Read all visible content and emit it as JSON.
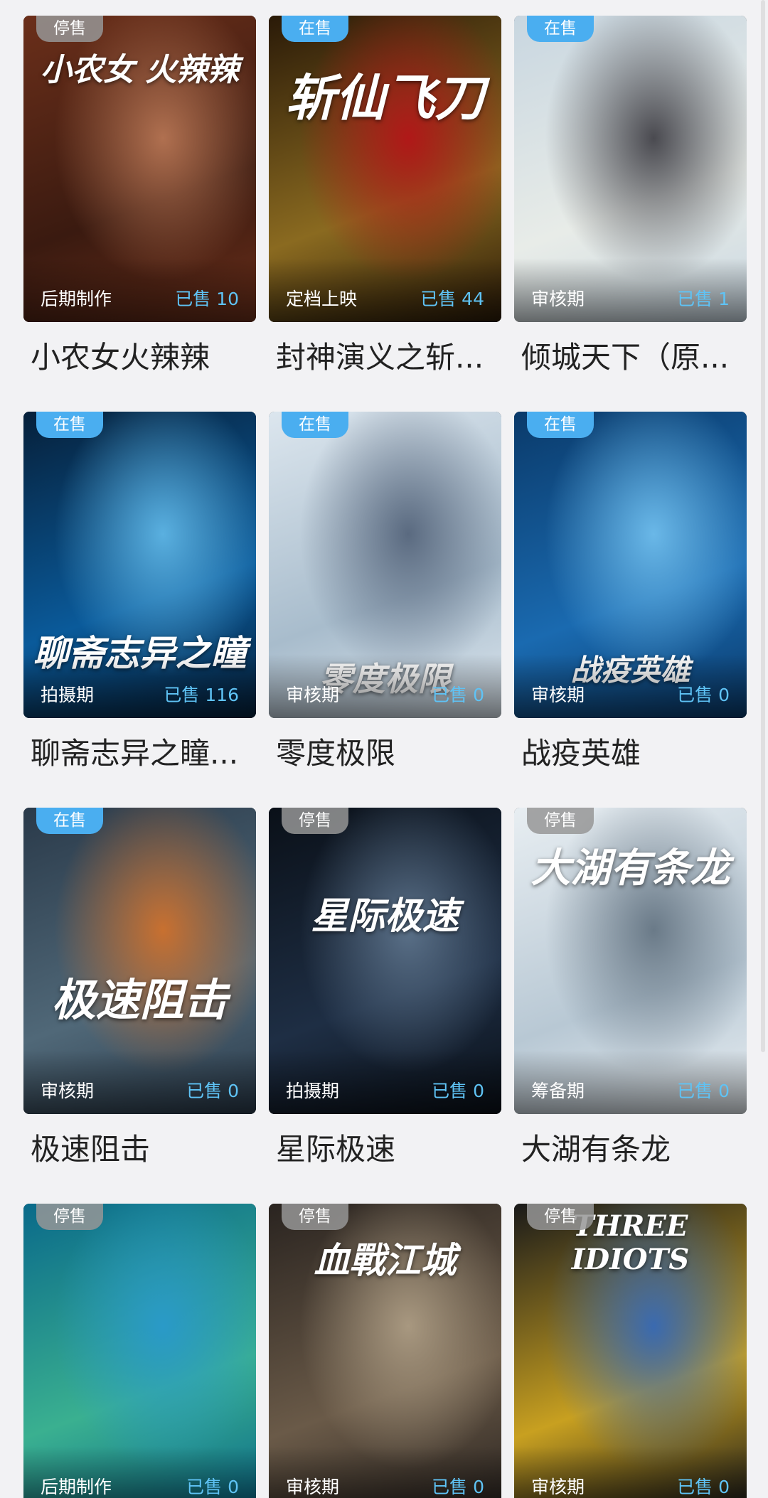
{
  "cards": [
    {
      "badge": "停售",
      "badge_state": "off",
      "stage": "后期制作",
      "sold": "已售 10",
      "name": "小农女火辣辣",
      "poster_text": "小农女 火辣辣",
      "colors": [
        "#6b2f1a",
        "#3a1a10",
        "#b07050"
      ]
    },
    {
      "badge": "在售",
      "badge_state": "on",
      "stage": "定档上映",
      "sold": "已售 44",
      "name": "封神演义之斩...",
      "poster_text": "斩仙飞刀",
      "colors": [
        "#2a1a08",
        "#8a6a20",
        "#b01818"
      ]
    },
    {
      "badge": "在售",
      "badge_state": "on",
      "stage": "审核期",
      "sold": "已售 1",
      "name": "倾城天下（原...",
      "poster_text": "",
      "colors": [
        "#c8d6e0",
        "#e8ece8",
        "#4a4a50"
      ]
    },
    {
      "badge": "在售",
      "badge_state": "on",
      "stage": "拍摄期",
      "sold": "已售 116",
      "name": "聊斋志异之瞳...",
      "poster_text": "聊斋志异之瞳",
      "colors": [
        "#06203a",
        "#0a5a9a",
        "#5ab0e0"
      ]
    },
    {
      "badge": "在售",
      "badge_state": "on",
      "stage": "审核期",
      "sold": "已售 0",
      "name": "零度极限",
      "poster_text": "零度极限",
      "colors": [
        "#dce6ee",
        "#a8bccc",
        "#5a6a80"
      ]
    },
    {
      "badge": "在售",
      "badge_state": "on",
      "stage": "审核期",
      "sold": "已售 0",
      "name": "战疫英雄",
      "poster_text": "战疫英雄",
      "colors": [
        "#0a3a6a",
        "#1a6ab0",
        "#6ab8e8"
      ]
    },
    {
      "badge": "在售",
      "badge_state": "on",
      "stage": "审核期",
      "sold": "已售 0",
      "name": "极速阻击",
      "poster_text": "极速阻击",
      "colors": [
        "#2a3a4a",
        "#506878",
        "#c87030"
      ]
    },
    {
      "badge": "停售",
      "badge_state": "off",
      "stage": "拍摄期",
      "sold": "已售 0",
      "name": "星际极速",
      "poster_text": "星际极速",
      "colors": [
        "#0a1018",
        "#1e2e44",
        "#5a7088"
      ]
    },
    {
      "badge": "停售",
      "badge_state": "off",
      "stage": "筹备期",
      "sold": "已售 0",
      "name": "大湖有条龙",
      "poster_text": "大湖有条龙",
      "colors": [
        "#e8eef2",
        "#b8c8d4",
        "#6a7a88"
      ]
    },
    {
      "badge": "停售",
      "badge_state": "off",
      "stage": "后期制作",
      "sold": "已售 0",
      "name": "",
      "poster_text": "",
      "colors": [
        "#0a6a8a",
        "#3ab090",
        "#2a9ac8"
      ]
    },
    {
      "badge": "停售",
      "badge_state": "off",
      "stage": "审核期",
      "sold": "已售 0",
      "name": "",
      "poster_text": "血戰江城",
      "colors": [
        "#2a2420",
        "#6a5a48",
        "#a89880"
      ]
    },
    {
      "badge": "停售",
      "badge_state": "off",
      "stage": "审核期",
      "sold": "已售 0",
      "name": "",
      "poster_text": "THREE IDIOTS",
      "colors": [
        "#1a1a1a",
        "#c8a020",
        "#3a6ab0"
      ]
    }
  ]
}
